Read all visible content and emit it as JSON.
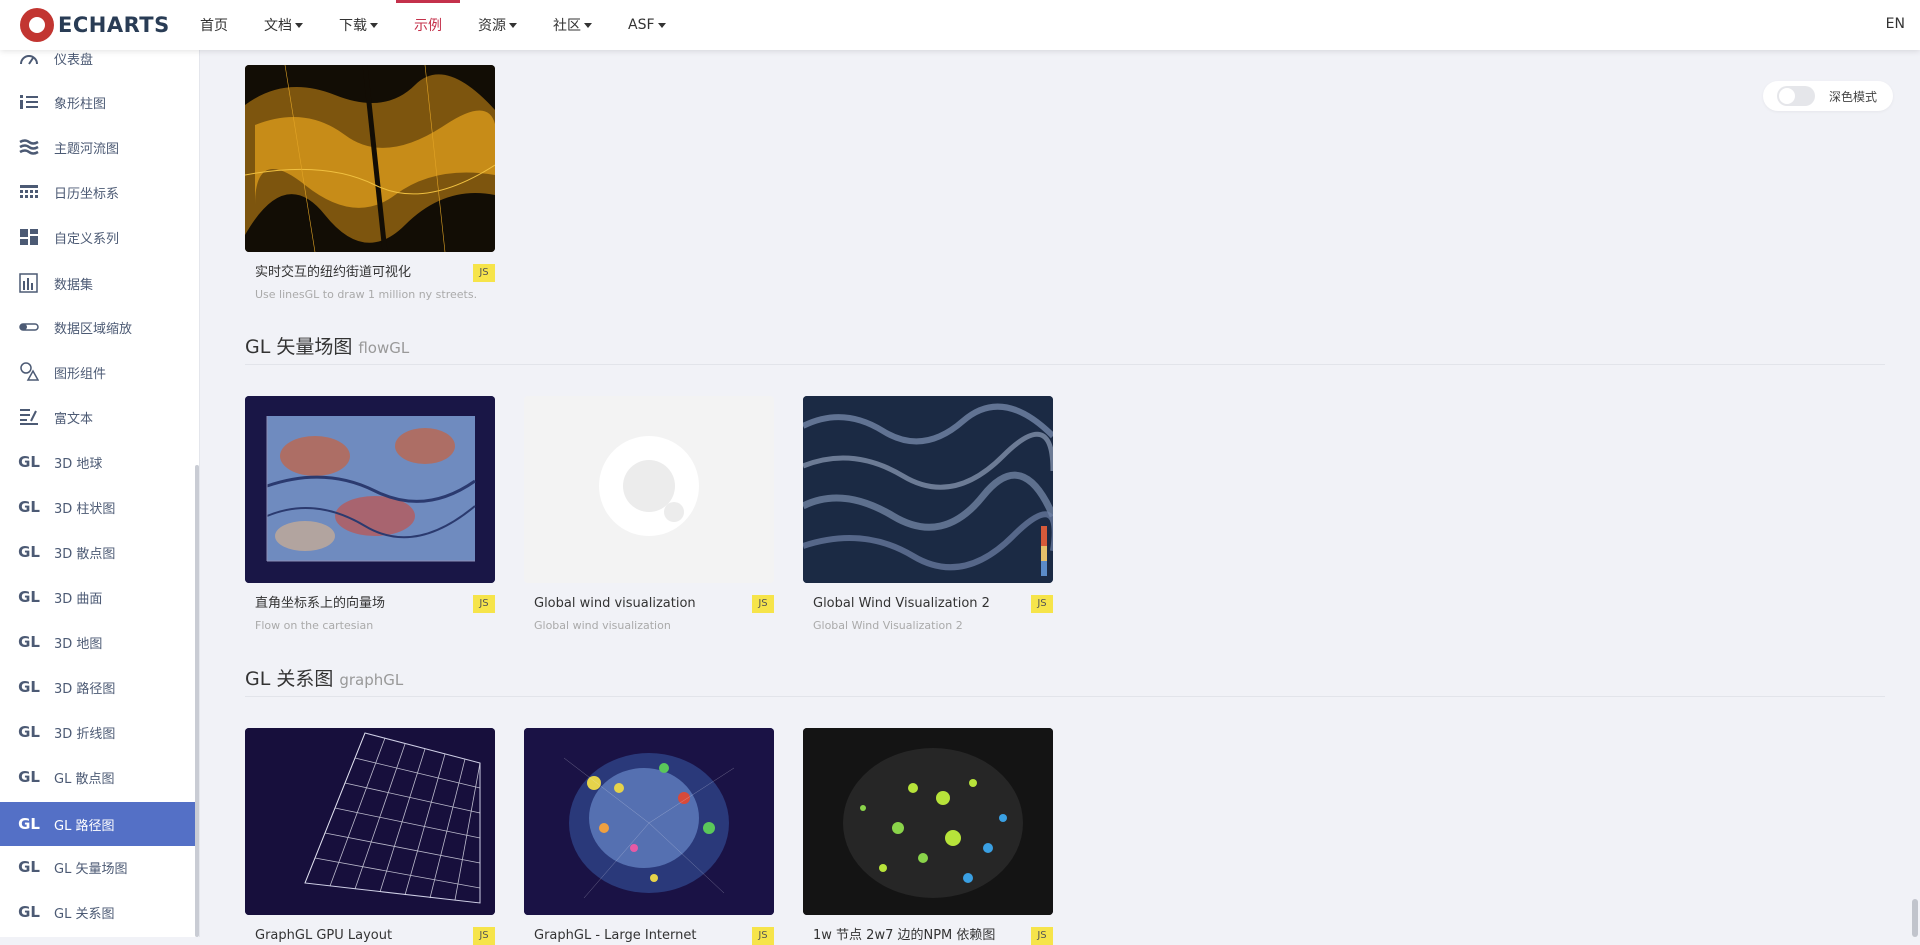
{
  "header": {
    "logo_text": "ECHARTS",
    "nav": [
      {
        "label": "首页",
        "caret": false,
        "active": false
      },
      {
        "label": "文档",
        "caret": true,
        "active": false
      },
      {
        "label": "下载",
        "caret": true,
        "active": false
      },
      {
        "label": "示例",
        "caret": false,
        "active": true
      },
      {
        "label": "资源",
        "caret": true,
        "active": false
      },
      {
        "label": "社区",
        "caret": true,
        "active": false
      },
      {
        "label": "ASF",
        "caret": true,
        "active": false
      }
    ],
    "lang": "EN"
  },
  "sidebar": {
    "items": [
      {
        "label": "仪表盘",
        "icon": "gauge-icon",
        "active": false
      },
      {
        "label": "象形柱图",
        "icon": "pictorial-bar-icon",
        "active": false
      },
      {
        "label": "主题河流图",
        "icon": "theme-river-icon",
        "active": false
      },
      {
        "label": "日历坐标系",
        "icon": "calendar-icon",
        "active": false
      },
      {
        "label": "自定义系列",
        "icon": "custom-series-icon",
        "active": false
      },
      {
        "label": "数据集",
        "icon": "dataset-icon",
        "active": false
      },
      {
        "label": "数据区域缩放",
        "icon": "datazoom-icon",
        "active": false
      },
      {
        "label": "图形组件",
        "icon": "graphic-icon",
        "active": false
      },
      {
        "label": "富文本",
        "icon": "rich-text-icon",
        "active": false
      },
      {
        "label": "3D 地球",
        "icon": "gl-icon",
        "active": false
      },
      {
        "label": "3D 柱状图",
        "icon": "gl-icon",
        "active": false
      },
      {
        "label": "3D 散点图",
        "icon": "gl-icon",
        "active": false
      },
      {
        "label": "3D 曲面",
        "icon": "gl-icon",
        "active": false
      },
      {
        "label": "3D 地图",
        "icon": "gl-icon",
        "active": false
      },
      {
        "label": "3D 路径图",
        "icon": "gl-icon",
        "active": false
      },
      {
        "label": "3D 折线图",
        "icon": "gl-icon",
        "active": false
      },
      {
        "label": "GL 散点图",
        "icon": "gl-icon",
        "active": false
      },
      {
        "label": "GL 路径图",
        "icon": "gl-icon",
        "active": true
      },
      {
        "label": "GL 矢量场图",
        "icon": "gl-icon",
        "active": false
      },
      {
        "label": "GL 关系图",
        "icon": "gl-icon",
        "active": false
      }
    ],
    "gl_glyph": "GL"
  },
  "dark_mode": {
    "label": "深色模式",
    "on": false
  },
  "cards_top": [
    {
      "title": "实时交互的纽约街道可视化",
      "badge": "JS",
      "subtitle": "Use linesGL to draw 1 million ny streets."
    }
  ],
  "section_flow": {
    "title": "GL 矢量场图",
    "en": "flowGL",
    "cards": [
      {
        "title": "直角坐标系上的向量场",
        "badge": "JS",
        "subtitle": "Flow on the cartesian"
      },
      {
        "title": "Global wind visualization",
        "badge": "JS",
        "subtitle": "Global wind visualization"
      },
      {
        "title": "Global Wind Visualization 2",
        "badge": "JS",
        "subtitle": "Global Wind Visualization 2"
      }
    ]
  },
  "section_graph": {
    "title": "GL 关系图",
    "en": "graphGL",
    "cards": [
      {
        "title": "GraphGL GPU Layout",
        "badge": "JS",
        "subtitle": ""
      },
      {
        "title": "GraphGL - Large Internet",
        "badge": "JS",
        "subtitle": ""
      },
      {
        "title": "1w 节点 2w7 边的NPM 依赖图",
        "badge": "JS",
        "subtitle": ""
      }
    ]
  }
}
